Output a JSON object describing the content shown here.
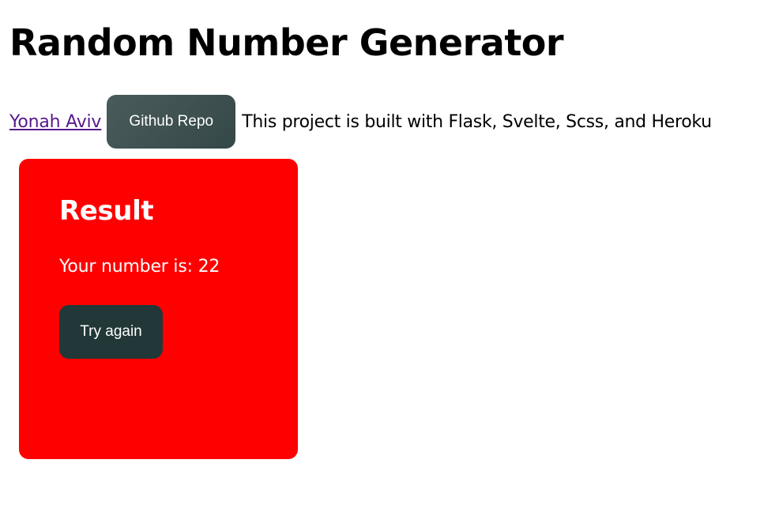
{
  "header": {
    "title": "Random Number Generator"
  },
  "info": {
    "author_link": "Yonah Aviv",
    "repo_button": "Github Repo",
    "description": "This project is built with Flask, Svelte, Scss, and Heroku"
  },
  "result": {
    "title": "Result",
    "prefix": "Your number is: ",
    "number": "22",
    "try_again_label": "Try again"
  },
  "colors": {
    "card_background": "#ff0000",
    "button_background": "#223838",
    "repo_button_background": "#415252",
    "link": "#551a8b"
  }
}
